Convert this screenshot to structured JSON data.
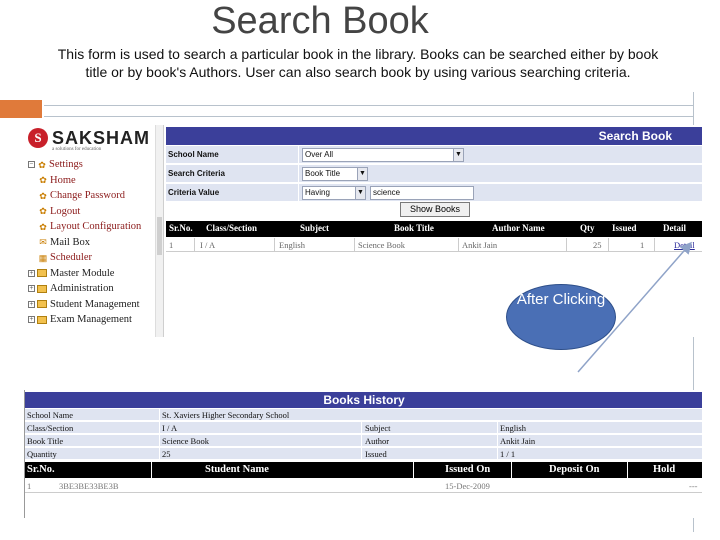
{
  "slide": {
    "title": "Search Book",
    "description": "This form is used to search a particular book in the library. Books can be searched either by book title or by book's Authors. User can also search book by using various searching criteria.",
    "callout": "After Clicking"
  },
  "app": {
    "logo_letter": "S",
    "logo_name": "SAKSHAM",
    "logo_tagline": "a solutions for education",
    "tree": [
      {
        "label": "Settings",
        "icon": "gear-icon"
      },
      {
        "label": "Home",
        "icon": "gear-icon"
      },
      {
        "label": "Change Password",
        "icon": "gear-icon"
      },
      {
        "label": "Logout",
        "icon": "gear-icon"
      },
      {
        "label": "Layout Configuration",
        "icon": "gear-icon"
      },
      {
        "label": "Mail Box",
        "icon": "mail-icon"
      },
      {
        "label": "Scheduler",
        "icon": "calendar-icon"
      },
      {
        "label": "Master Module",
        "icon": "folder-icon"
      },
      {
        "label": "Administration",
        "icon": "folder-icon"
      },
      {
        "label": "Student Management",
        "icon": "folder-icon"
      },
      {
        "label": "Exam Management",
        "icon": "folder-icon"
      }
    ]
  },
  "search_form": {
    "header": "Search Book",
    "school_name_label": "School Name",
    "school_name_value": "Over All",
    "criteria_label": "Search Criteria",
    "criteria_value": "Book Title",
    "criteria_value_label": "Criteria Value",
    "criteria_op": "Having",
    "criteria_text": "science",
    "show_button": "Show Books",
    "columns": [
      "Sr.No.",
      "Class/Section",
      "Subject",
      "Book Title",
      "Author Name",
      "Qty",
      "Issued",
      "Detail"
    ],
    "rows": [
      [
        "1",
        "I / A",
        "English",
        "Science Book",
        "Ankit Jain",
        "25",
        "1",
        "Detail"
      ]
    ]
  },
  "books_history": {
    "header": "Books History",
    "fields": [
      {
        "label": "School Name",
        "value": "St. Xaviers Higher Secondary School"
      },
      {
        "label": "Class/Section",
        "value": "I / A",
        "label2": "Subject",
        "value2": "English"
      },
      {
        "label": "Book Title",
        "value": "Science Book",
        "label2": "Author",
        "value2": "Ankit Jain"
      },
      {
        "label": "Quantity",
        "value": "25",
        "label2": "Issued",
        "value2": "1 / 1"
      }
    ],
    "columns": [
      "Sr.No.",
      "Student Name",
      "Issued On",
      "Deposit On",
      "Hold"
    ],
    "rows": [
      [
        "1",
        "3BE3BE33BE3B",
        "15-Dec-2009",
        "",
        "---"
      ]
    ]
  }
}
